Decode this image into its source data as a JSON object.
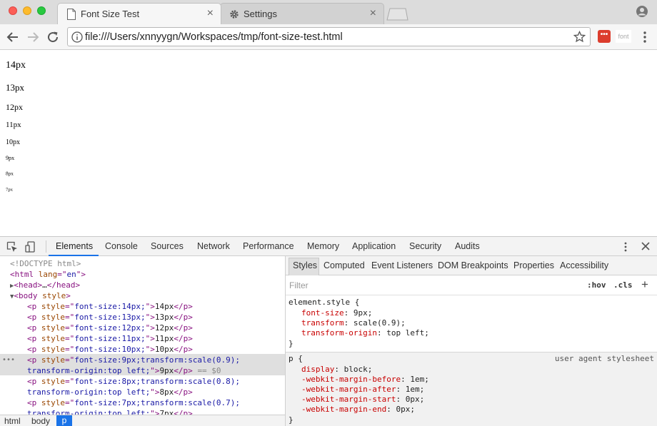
{
  "tabs": [
    {
      "title": "Font Size Test",
      "icon": "page-icon",
      "active": true
    },
    {
      "title": "Settings",
      "icon": "gear-icon",
      "active": false
    }
  ],
  "toolbar": {
    "url": "file:///Users/xnnyygn/Workspaces/tmp/font-size-test.html",
    "ext_font_label": "font"
  },
  "page": {
    "lines": [
      {
        "text": "14px",
        "font_size": 14,
        "scale": 1
      },
      {
        "text": "13px",
        "font_size": 13,
        "scale": 1
      },
      {
        "text": "12px",
        "font_size": 12,
        "scale": 1
      },
      {
        "text": "11px",
        "font_size": 11,
        "scale": 1
      },
      {
        "text": "10px",
        "font_size": 10,
        "scale": 1
      },
      {
        "text": "9px",
        "font_size": 9,
        "scale": 0.9
      },
      {
        "text": "8px",
        "font_size": 8,
        "scale": 0.8
      },
      {
        "text": "7px",
        "font_size": 7,
        "scale": 0.7
      }
    ]
  },
  "devtools": {
    "tabs": [
      "Elements",
      "Console",
      "Sources",
      "Network",
      "Performance",
      "Memory",
      "Application",
      "Security",
      "Audits"
    ],
    "active_tab": "Elements",
    "dom": {
      "doctype": "<!DOCTYPE html>",
      "html_open": "<html lang=\"en\">",
      "head": "<head>…</head>",
      "body_open": "<body style>",
      "selected_suffix": "== $0"
    },
    "breadcrumbs": [
      "html",
      "body",
      "p"
    ],
    "styles_tabs": [
      "Styles",
      "Computed",
      "Event Listeners",
      "DOM Breakpoints",
      "Properties",
      "Accessibility"
    ],
    "filter_placeholder": "Filter",
    "hov_label": ":hov",
    "cls_label": ".cls",
    "element_style": {
      "selector": "element.style {",
      "props": [
        {
          "name": "font-size",
          "value": "9px;"
        },
        {
          "name": "transform",
          "value": "scale(0.9);"
        },
        {
          "name": "transform-origin",
          "value": "top left;"
        }
      ],
      "close": "}"
    },
    "ua_rule": {
      "selector": "p {",
      "source": "user agent stylesheet",
      "props": [
        {
          "name": "display",
          "value": "block;"
        },
        {
          "name": "-webkit-margin-before",
          "value": "1em;"
        },
        {
          "name": "-webkit-margin-after",
          "value": "1em;"
        },
        {
          "name": "-webkit-margin-start",
          "value": "0px;"
        },
        {
          "name": "-webkit-margin-end",
          "value": "0px;"
        }
      ],
      "close": "}"
    }
  }
}
